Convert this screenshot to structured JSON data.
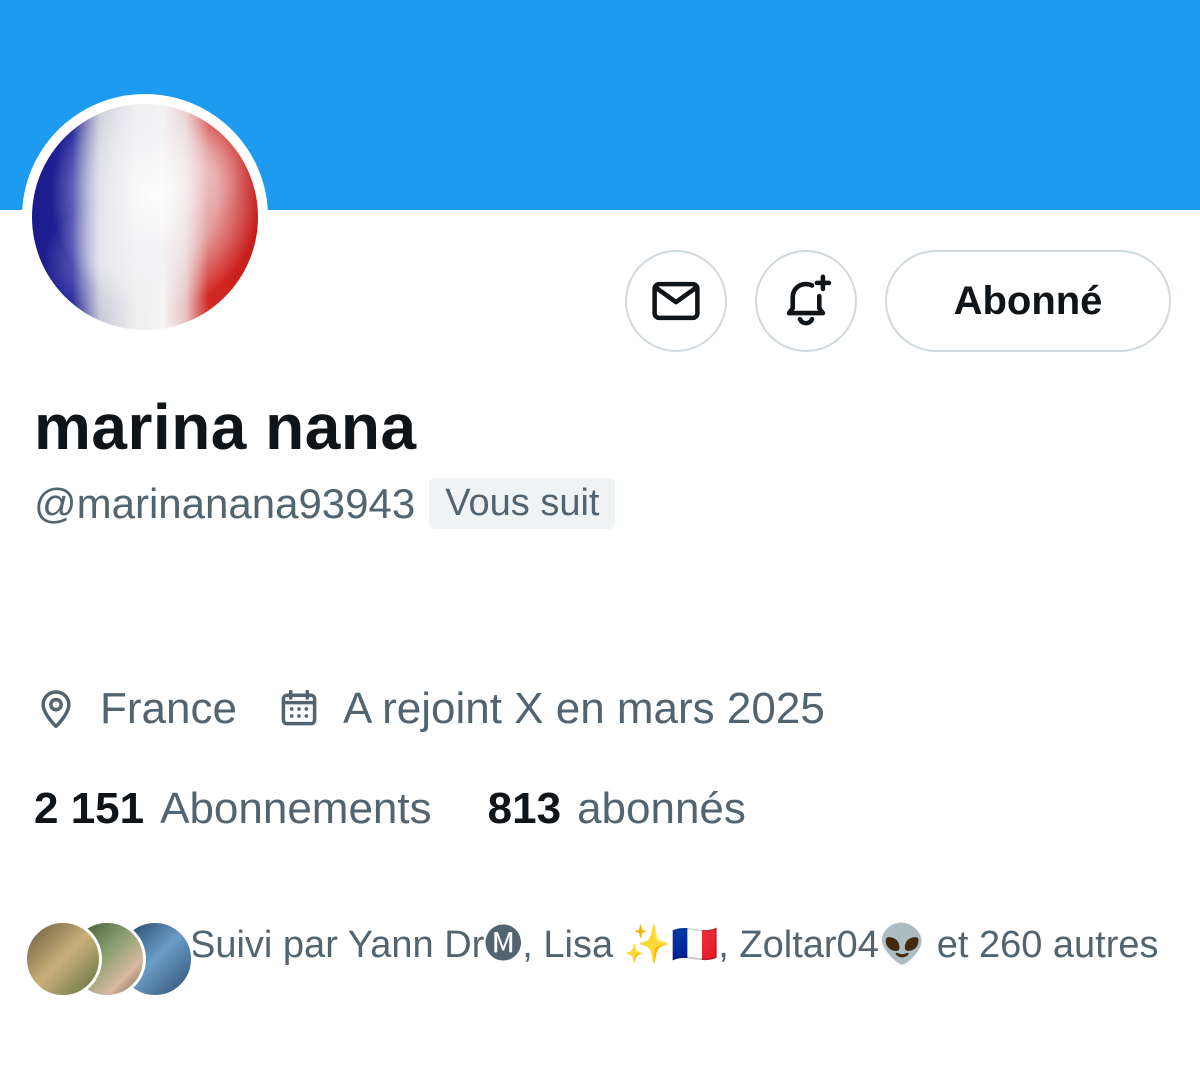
{
  "colors": {
    "banner": "#1d9bf0",
    "text_primary": "#0f1419",
    "text_secondary": "#536471",
    "border": "#cfd9de",
    "badge_bg": "#eff3f4"
  },
  "header": {
    "message_icon": "envelope-icon",
    "notify_icon": "bell-plus-icon",
    "follow_label": "Abonné"
  },
  "profile": {
    "display_name": "marina nana",
    "handle": "@marinanana93943",
    "follows_you": "Vous suit",
    "location": "France",
    "joined": "A rejoint X en mars 2025"
  },
  "stats": {
    "following_count": "2 151",
    "following_label": "Abonnements",
    "followers_count": "813",
    "followers_label": "abonnés"
  },
  "followed_by": {
    "text": "Suivi par Yann Dr🅜, Lisa ✨🇫🇷, Zoltar04👽 et 260 autres"
  }
}
